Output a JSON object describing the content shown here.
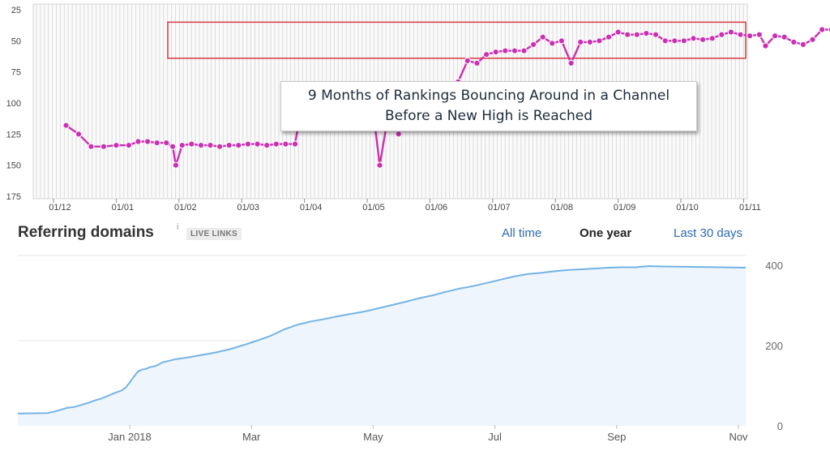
{
  "colors": {
    "rank_line": "#cc2fb3",
    "rank_marker_fill": "#ffffff",
    "channel_box": "#d9454a",
    "domains_line": "#74b3e6",
    "domains_fill": "#eef5fc",
    "active_tab": "#222222",
    "link_tab": "#2a6ab5"
  },
  "annotation": {
    "line1": "9 Months of Rankings Bouncing Around in a Channel",
    "line2": "Before a New High is Reached"
  },
  "referring_domains": {
    "title": "Referring domains",
    "info_icon": "i",
    "badge": "LIVE LINKS",
    "tabs": {
      "all_time": "All time",
      "one_year": "One year",
      "last_30_days": "Last 30 days"
    }
  },
  "chart_data": [
    {
      "type": "line",
      "series": [
        {
          "values": [
            [
              0.2,
              118
            ],
            [
              0.4,
              125
            ],
            [
              0.6,
              135
            ],
            [
              0.8,
              135
            ],
            [
              1.0,
              134
            ],
            [
              1.2,
              134
            ],
            [
              1.35,
              131
            ],
            [
              1.5,
              131
            ],
            [
              1.65,
              132
            ],
            [
              1.8,
              132
            ],
            [
              1.9,
              135
            ],
            [
              1.95,
              150
            ],
            [
              2.05,
              134
            ],
            [
              2.2,
              133
            ],
            [
              2.35,
              134
            ],
            [
              2.5,
              134
            ],
            [
              2.65,
              135
            ],
            [
              2.8,
              134
            ],
            [
              2.95,
              134
            ],
            [
              3.1,
              133
            ],
            [
              3.25,
              133
            ],
            [
              3.4,
              134
            ],
            [
              3.55,
              133
            ],
            [
              3.7,
              133
            ],
            [
              3.85,
              133
            ],
            [
              3.93,
              109
            ],
            [
              4.05,
              109
            ],
            [
              4.2,
              108
            ],
            [
              4.35,
              108
            ],
            [
              4.5,
              108
            ],
            [
              4.65,
              108
            ],
            [
              4.8,
              108
            ],
            [
              4.95,
              108
            ],
            [
              5.1,
              108
            ],
            [
              5.2,
              150
            ],
            [
              5.35,
              105
            ],
            [
              5.5,
              125
            ],
            [
              5.65,
              107
            ],
            [
              5.85,
              106
            ],
            [
              6.0,
              106
            ],
            [
              6.15,
              106
            ],
            [
              6.3,
              104
            ],
            [
              6.45,
              83
            ],
            [
              6.6,
              66
            ],
            [
              6.75,
              68
            ],
            [
              6.9,
              61
            ],
            [
              7.05,
              59
            ],
            [
              7.2,
              58
            ],
            [
              7.35,
              58
            ],
            [
              7.5,
              58
            ],
            [
              7.65,
              53
            ],
            [
              7.8,
              47
            ],
            [
              7.95,
              52
            ],
            [
              8.1,
              50
            ],
            [
              8.25,
              68
            ],
            [
              8.4,
              51
            ],
            [
              8.55,
              51
            ],
            [
              8.7,
              50
            ],
            [
              8.85,
              47
            ],
            [
              9.0,
              43
            ],
            [
              9.15,
              45
            ],
            [
              9.3,
              45
            ],
            [
              9.45,
              44
            ],
            [
              9.6,
              45
            ],
            [
              9.75,
              50
            ],
            [
              9.9,
              50
            ],
            [
              10.05,
              50
            ],
            [
              10.2,
              48
            ],
            [
              10.35,
              49
            ],
            [
              10.5,
              48
            ],
            [
              10.65,
              45
            ],
            [
              10.8,
              43
            ],
            [
              10.95,
              45
            ],
            [
              11.1,
              46
            ],
            [
              11.25,
              45
            ],
            [
              11.35,
              54
            ],
            [
              11.5,
              46
            ],
            [
              11.65,
              47
            ],
            [
              11.8,
              51
            ],
            [
              11.95,
              53
            ],
            [
              12.1,
              49
            ],
            [
              12.25,
              41
            ],
            [
              12.4,
              41
            ],
            [
              12.55,
              42
            ],
            [
              12.7,
              56
            ],
            [
              12.8,
              51
            ],
            [
              12.95,
              53
            ],
            [
              13.1,
              51
            ],
            [
              13.25,
              57
            ],
            [
              13.4,
              50
            ],
            [
              13.55,
              47
            ],
            [
              13.7,
              41
            ],
            [
              13.85,
              40
            ],
            [
              14.0,
              47
            ],
            [
              14.15,
              53
            ],
            [
              14.3,
              51
            ],
            [
              14.45,
              73
            ],
            [
              14.6,
              60
            ],
            [
              14.75,
              59
            ],
            [
              14.9,
              59
            ],
            [
              15.05,
              49
            ],
            [
              15.2,
              63
            ],
            [
              15.35,
              52
            ],
            [
              15.5,
              38
            ],
            [
              15.65,
              50
            ],
            [
              15.8,
              49
            ],
            [
              15.95,
              52
            ],
            [
              16.1,
              50
            ],
            [
              16.25,
              50
            ],
            [
              16.4,
              50
            ],
            [
              16.55,
              49
            ],
            [
              16.7,
              44
            ],
            [
              16.85,
              46
            ],
            [
              17.0,
              31
            ],
            [
              17.15,
              31
            ],
            [
              17.3,
              31
            ],
            [
              17.45,
              33
            ],
            [
              17.6,
              35
            ],
            [
              17.75,
              45
            ],
            [
              17.9,
              46
            ],
            [
              18.05,
              45
            ],
            [
              18.2,
              44
            ],
            [
              18.35,
              44
            ],
            [
              18.5,
              43
            ],
            [
              18.65,
              45
            ],
            [
              18.8,
              46
            ],
            [
              18.95,
              51
            ],
            [
              19.1,
              49
            ],
            [
              19.25,
              51
            ],
            [
              19.4,
              44
            ],
            [
              19.55,
              41
            ],
            [
              19.7,
              44
            ],
            [
              19.85,
              34
            ],
            [
              20.0,
              46
            ],
            [
              20.15,
              46
            ],
            [
              20.3,
              33
            ],
            [
              20.45,
              23
            ]
          ]
        }
      ],
      "xtick_labels": [
        "01/12",
        "01/01",
        "01/02",
        "01/03",
        "01/04",
        "01/05",
        "01/06",
        "01/07",
        "01/08",
        "01/09",
        "01/10",
        "01/11"
      ],
      "ytick_labels": [
        "25",
        "50",
        "75",
        "100",
        "125",
        "150",
        "175"
      ],
      "ylim": [
        25,
        175
      ],
      "y_inverted": true,
      "grid": true,
      "highlight_channel": {
        "from": 35,
        "to": 64
      }
    },
    {
      "type": "area",
      "series": [
        {
          "values": [
            [
              0,
              31
            ],
            [
              0.5,
              32
            ],
            [
              1,
              35
            ],
            [
              1.5,
              40
            ],
            [
              2,
              45
            ],
            [
              2.5,
              47
            ],
            [
              3,
              52
            ],
            [
              3.5,
              57
            ],
            [
              4,
              63
            ],
            [
              4.5,
              68
            ],
            [
              5,
              75
            ],
            [
              5.5,
              82
            ],
            [
              6,
              88
            ],
            [
              6.3,
              95
            ],
            [
              6.6,
              108
            ],
            [
              6.9,
              122
            ],
            [
              7.2,
              135
            ],
            [
              7.5,
              140
            ],
            [
              7.8,
              142
            ],
            [
              8.1,
              146
            ],
            [
              8.4,
              148
            ],
            [
              8.7,
              152
            ],
            [
              9,
              158
            ],
            [
              9.5,
              162
            ],
            [
              10,
              166
            ],
            [
              11,
              171
            ],
            [
              12,
              177
            ],
            [
              13,
              183
            ],
            [
              14,
              191
            ],
            [
              15,
              201
            ],
            [
              16,
              212
            ],
            [
              17,
              224
            ],
            [
              18,
              240
            ],
            [
              19,
              252
            ],
            [
              20,
              260
            ],
            [
              21,
              266
            ],
            [
              22,
              273
            ],
            [
              23,
              279
            ],
            [
              24,
              285
            ],
            [
              25,
              293
            ],
            [
              26,
              301
            ],
            [
              27,
              309
            ],
            [
              28,
              318
            ],
            [
              29,
              325
            ],
            [
              30,
              334
            ],
            [
              31,
              342
            ],
            [
              32,
              348
            ],
            [
              33,
              356
            ],
            [
              34,
              364
            ],
            [
              35,
              372
            ],
            [
              36,
              378
            ],
            [
              37,
              381
            ],
            [
              38,
              385
            ],
            [
              39,
              388
            ],
            [
              40,
              390
            ],
            [
              41,
              392
            ],
            [
              42,
              394
            ],
            [
              43,
              395
            ],
            [
              44,
              395
            ],
            [
              45,
              398
            ],
            [
              46,
              397
            ],
            [
              46.3,
              394
            ]
          ]
        }
      ],
      "xtick_labels": [
        "Jan 2018",
        "Mar",
        "May",
        "Jul",
        "Sep",
        "Nov"
      ],
      "ytick_labels": [
        "400",
        "200",
        "0"
      ],
      "ylim": [
        0,
        420
      ],
      "grid": true
    }
  ]
}
